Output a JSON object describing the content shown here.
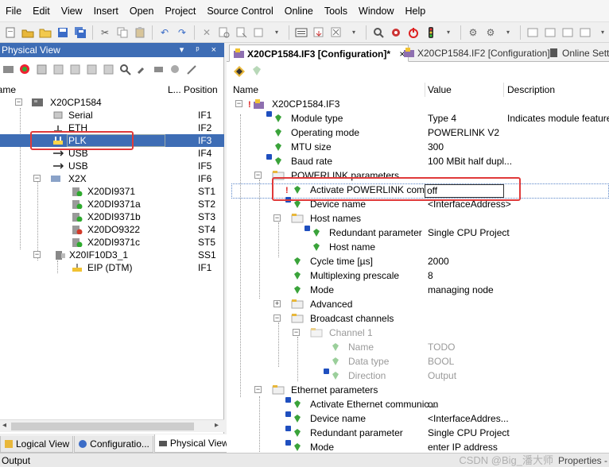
{
  "menu": [
    "File",
    "Edit",
    "View",
    "Insert",
    "Open",
    "Project",
    "Source Control",
    "Online",
    "Tools",
    "Window",
    "Help"
  ],
  "left_panel": {
    "title": "Physical View",
    "title_controls": "▾ ᵖ ×",
    "columns": {
      "name": "Name",
      "l": "L...",
      "position": "Position"
    },
    "rows": [
      {
        "name": "X20CP1584",
        "pos": ""
      },
      {
        "name": "Serial",
        "pos": "IF1"
      },
      {
        "name": "ETH",
        "pos": "IF2"
      },
      {
        "name": "PLK",
        "pos": "IF3"
      },
      {
        "name": "USB",
        "pos": "IF4"
      },
      {
        "name": "USB",
        "pos": "IF5"
      },
      {
        "name": "X2X",
        "pos": "IF6"
      },
      {
        "name": "X20DI9371",
        "pos": "ST1"
      },
      {
        "name": "X20DI9371a",
        "pos": "ST2"
      },
      {
        "name": "X20DI9371b",
        "pos": "ST3"
      },
      {
        "name": "X20DO9322",
        "pos": "ST4"
      },
      {
        "name": "X20DI9371c",
        "pos": "ST5"
      },
      {
        "name": "X20IF10D3_1",
        "pos": "SS1"
      },
      {
        "name": "EIP (DTM)",
        "pos": "IF1"
      }
    ],
    "bottom_tabs": [
      "Logical View",
      "Configuratio...",
      "Physical View"
    ]
  },
  "right_panel": {
    "tabs": [
      {
        "label": "X20CP1584.IF3 [Configuration]*",
        "close": "×"
      },
      {
        "label": "X20CP1584.IF2 [Configuration]"
      },
      {
        "label": "Online Setti"
      }
    ],
    "columns": {
      "name": "Name",
      "value": "Value",
      "description": "Description"
    },
    "rows": [
      {
        "name": "X20CP1584.IF3",
        "value": "",
        "desc": ""
      },
      {
        "name": "Module type",
        "value": "Type 4",
        "desc": "Indicates module features"
      },
      {
        "name": "Operating mode",
        "value": "POWERLINK V2",
        "desc": ""
      },
      {
        "name": "MTU size",
        "value": "300",
        "desc": ""
      },
      {
        "name": "Baud rate",
        "value": "100 MBit half dupl...",
        "desc": ""
      },
      {
        "name": "POWERLINK parameters",
        "value": "",
        "desc": ""
      },
      {
        "name": "Activate POWERLINK com...",
        "value": "off",
        "desc": ""
      },
      {
        "name": "Device name",
        "value": "<InterfaceAddress>",
        "desc": ""
      },
      {
        "name": "Host names",
        "value": "",
        "desc": ""
      },
      {
        "name": "Redundant parameter",
        "value": "Single CPU Project",
        "desc": ""
      },
      {
        "name": "Host name",
        "value": "",
        "desc": ""
      },
      {
        "name": "Cycle time [µs]",
        "value": "2000",
        "desc": ""
      },
      {
        "name": "Multiplexing prescale",
        "value": "8",
        "desc": ""
      },
      {
        "name": "Mode",
        "value": "managing node",
        "desc": ""
      },
      {
        "name": "Advanced",
        "value": "",
        "desc": ""
      },
      {
        "name": "Broadcast channels",
        "value": "",
        "desc": ""
      },
      {
        "name": "Channel 1",
        "value": "",
        "desc": ""
      },
      {
        "name": "Name",
        "value": "TODO",
        "desc": ""
      },
      {
        "name": "Data type",
        "value": "BOOL",
        "desc": ""
      },
      {
        "name": "Direction",
        "value": "Output",
        "desc": ""
      },
      {
        "name": "Ethernet parameters",
        "value": "",
        "desc": ""
      },
      {
        "name": "Activate Ethernet communic...",
        "value": "on",
        "desc": ""
      },
      {
        "name": "Device name",
        "value": "<InterfaceAddres...",
        "desc": ""
      },
      {
        "name": "Redundant parameter",
        "value": "Single CPU Project",
        "desc": ""
      },
      {
        "name": "Mode",
        "value": "enter IP address",
        "desc": ""
      }
    ]
  },
  "status": {
    "output": "Output",
    "watermark": "CSDN @Big_潘大师",
    "properties": "Properties -"
  },
  "colors": {
    "selection": "#3e6db5",
    "highlight": "#e03a3a",
    "gem": "#3aa33a"
  }
}
